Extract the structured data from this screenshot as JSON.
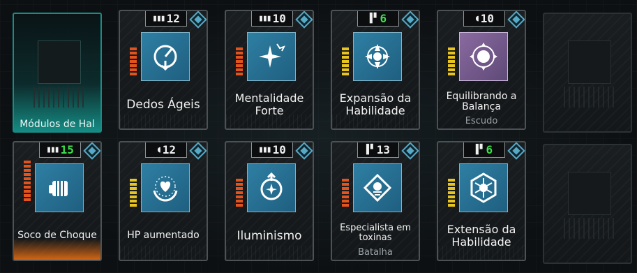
{
  "slots": [
    {
      "label": "Módulos de Hal",
      "accent": "#16a096"
    },
    {
      "label": "",
      "accent": "#e66e14"
    }
  ],
  "cards": [
    {
      "name": "Dedos Ágeis",
      "cost": "12",
      "cost_icon": "memory-icon",
      "cost_color": "#f1f1f1",
      "tag": "",
      "icon": "finger-dial-icon",
      "level_color": "#e5531c"
    },
    {
      "name": "Mentalidade Forte",
      "cost": "10",
      "cost_icon": "memory-icon",
      "cost_color": "#f1f1f1",
      "tag": "",
      "icon": "sparkle-icon",
      "level_color": "#e5531c"
    },
    {
      "name": "Expansão da Habilidade",
      "cost": "6",
      "cost_icon": "cpu-icon",
      "cost_color": "#3ee04c",
      "tag": "",
      "icon": "expand-crosshair-icon",
      "level_color": "#e8c420"
    },
    {
      "name": "Equilibrando a Balança",
      "cost": "10",
      "cost_icon": "core-icon",
      "cost_color": "#f1f1f1",
      "tag": "Escudo",
      "icon": "balance-orb-icon",
      "level_color": "#e8c420"
    },
    {
      "name": "Soco de Choque",
      "cost": "15",
      "cost_icon": "memory-icon",
      "cost_color": "#3ee04c",
      "tag": "",
      "icon": "fist-icon",
      "level_color": "#e5531c"
    },
    {
      "name": "HP aumentado",
      "cost": "12",
      "cost_icon": "core-icon",
      "cost_color": "#f1f1f1",
      "tag": "",
      "icon": "heart-hands-icon",
      "level_color": "#e8c420"
    },
    {
      "name": "Iluminismo",
      "cost": "10",
      "cost_icon": "memory-icon",
      "cost_color": "#f1f1f1",
      "tag": "",
      "icon": "illumination-icon",
      "level_color": "#e5531c"
    },
    {
      "name": "Especialista em toxinas",
      "cost": "13",
      "cost_icon": "cpu-icon",
      "cost_color": "#f1f1f1",
      "tag": "Batalha",
      "icon": "toxin-icon",
      "level_color": "#e5531c"
    },
    {
      "name": "Extensão da Habilidade",
      "cost": "6",
      "cost_icon": "cpu-icon",
      "cost_color": "#3ee04c",
      "tag": "",
      "icon": "hex-extension-icon",
      "level_color": "#e8c420"
    }
  ]
}
